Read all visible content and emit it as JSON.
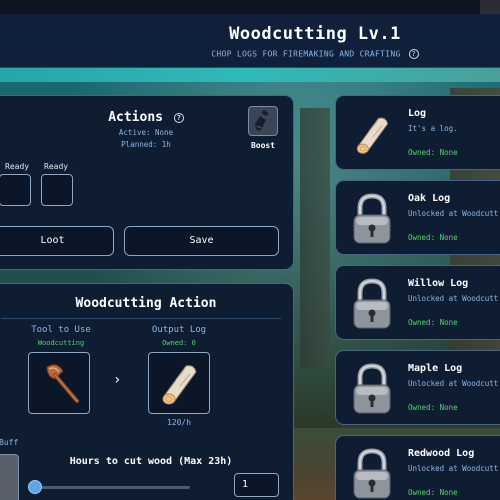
{
  "header": {
    "title": "Woodcutting Lv.1",
    "subtitle": "CHOP LOGS FOR FIREMAKING AND CRAFTING",
    "help_glyph": "?"
  },
  "actions_panel": {
    "title": "Actions",
    "help_glyph": "?",
    "active": "Active: None",
    "planned": "Planned: 1h",
    "boost_label": "Boost",
    "boost_icon": "potion-icon",
    "slots": [
      {
        "label": "Ready"
      },
      {
        "label": "Ready"
      }
    ],
    "loot_label": "Loot",
    "save_label": "Save"
  },
  "woodcutting_panel": {
    "title": "Woodcutting Action",
    "tool_label": "Tool to Use",
    "tool_skill": "Woodcutting",
    "tool_icon": "axe-icon",
    "arrow": "›",
    "output_label": "Output Log",
    "output_owned": "Owned: 0",
    "output_icon": "log-icon",
    "rate": "120/h",
    "buff_label": "Buff",
    "hours_label": "Hours to cut wood (Max 23h)",
    "hours_value": "1",
    "hours_fraction": 0.0
  },
  "logs": [
    {
      "name": "Log",
      "desc": "It's a log.",
      "owned": "Owned: None",
      "icon": "log-icon",
      "locked": false
    },
    {
      "name": "Oak Log",
      "desc": "Unlocked at Woodcutt",
      "owned": "Owned: None",
      "icon": "padlock-icon",
      "locked": true
    },
    {
      "name": "Willow Log",
      "desc": "Unlocked at Woodcutt",
      "owned": "Owned: None",
      "icon": "padlock-icon",
      "locked": true
    },
    {
      "name": "Maple Log",
      "desc": "Unlocked at Woodcutt",
      "owned": "Owned: None",
      "icon": "padlock-icon",
      "locked": true
    },
    {
      "name": "Redwood Log",
      "desc": "Unlocked at Woodcutt",
      "owned": "Owned: None",
      "icon": "padlock-icon",
      "locked": true
    }
  ],
  "colors": {
    "panel_bg": "#0f1d33",
    "accent_blue": "#8ab6e6",
    "owned_green": "#4fd66b",
    "border": "#4a6486"
  }
}
